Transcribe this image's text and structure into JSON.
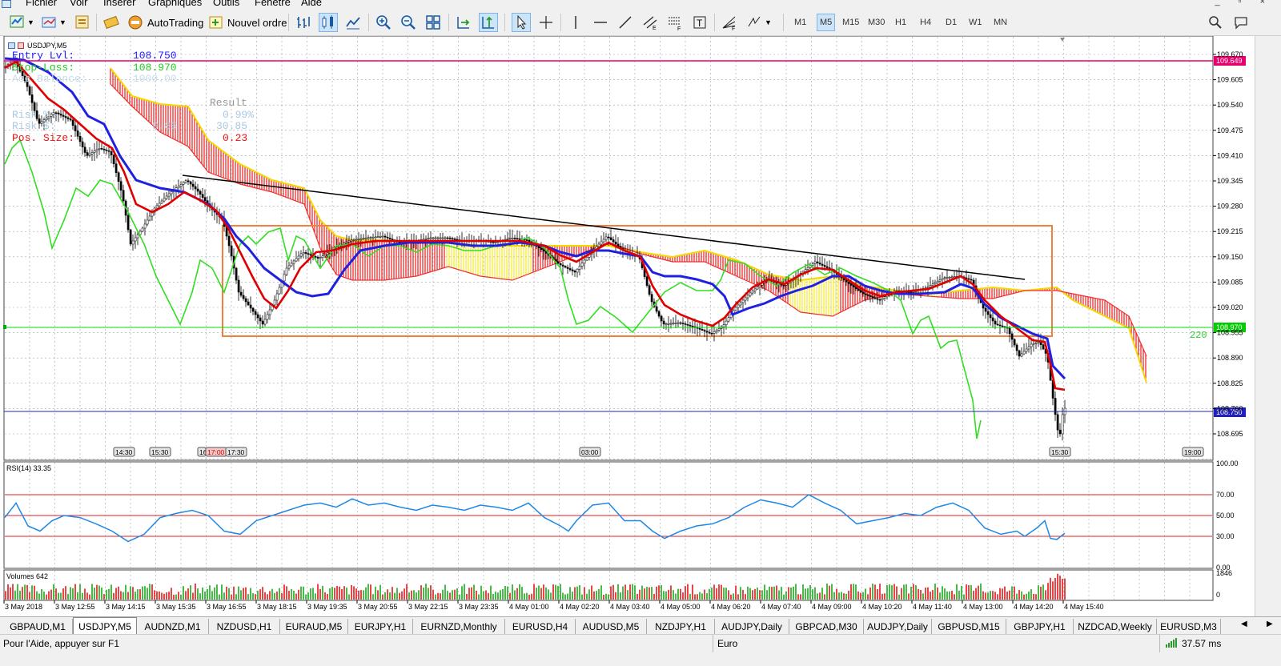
{
  "menu": {
    "items": [
      "Fichier",
      "Voir",
      "Insérer",
      "Graphiques",
      "Outils",
      "Fenêtre",
      "Aide"
    ]
  },
  "toolbar": {
    "autotrading_label": "AutoTrading",
    "new_order_label": "Nouvel ordre",
    "timeframes": [
      "M1",
      "M5",
      "M15",
      "M30",
      "H1",
      "H4",
      "D1",
      "W1",
      "MN"
    ],
    "active_timeframe": "M5"
  },
  "chart": {
    "symbol_title": "USDJPY,M5",
    "overlay": {
      "entry_label": "Entry Lvl:",
      "entry_value": "108.750",
      "stop_label": "Stop-Loss:",
      "stop_value": "108.970",
      "acc_label": "Acc Balance:",
      "acc_value": "1000.00",
      "result_header": "Result",
      "risk_pct_label": "Risk %:",
      "risk_pct_value": "0.99%",
      "risk_money_label": "Risk $:",
      "risk_money_value": "9.85",
      "risk_money_result": "30.85",
      "pos_label": "Pos. Size:",
      "pos_value": "0.23"
    },
    "price_axis": [
      "109.670",
      "109.605",
      "109.540",
      "109.475",
      "109.410",
      "109.345",
      "109.280",
      "109.215",
      "109.150",
      "109.085",
      "109.020",
      "108.955",
      "108.890",
      "108.825",
      "108.760",
      "108.695"
    ],
    "current_price_tag": "109.649",
    "stop_tag": "108.970",
    "entry_tag": "108.750",
    "pips_label": "220",
    "time_tags": [
      "14:30",
      "15:30",
      "16",
      "17:00",
      "17:30",
      "03:00",
      "15:30",
      "19:00"
    ],
    "time_axis": [
      "3 May 2018",
      "3 May 12:55",
      "3 May 14:15",
      "3 May 15:35",
      "3 May 16:55",
      "3 May 18:15",
      "3 May 19:35",
      "3 May 20:55",
      "3 May 22:15",
      "3 May 23:35",
      "4 May 01:00",
      "4 May 02:20",
      "4 May 03:40",
      "4 May 05:00",
      "4 May 06:20",
      "4 May 07:40",
      "4 May 09:00",
      "4 May 10:20",
      "4 May 11:40",
      "4 May 13:00",
      "4 May 14:20",
      "4 May 15:40"
    ],
    "colors": {
      "price_line": "#e8006e",
      "stop_line": "#00dd00",
      "entry_line": "#2020c0",
      "kijun": "#2020e0",
      "tenkan": "#e00000",
      "chikou": "#33dd22",
      "box": "#f08040",
      "trendline": "#000000"
    }
  },
  "rsi": {
    "label": "RSI(14) 33.35",
    "levels": [
      "100.00",
      "70.00",
      "50.00",
      "30.00",
      "0.00"
    ]
  },
  "volumes": {
    "label": "Volumes 642",
    "max": "1846",
    "min": "0"
  },
  "tabs": [
    "GBPAUD,M1",
    "USDJPY,M5",
    "AUDNZD,M1",
    "NZDUSD,H1",
    "EURAUD,M5",
    "EURJPY,H1",
    "EURNZD,Monthly",
    "EURUSD,H4",
    "AUDUSD,M5",
    "NZDJPY,H1",
    "AUDJPY,Daily",
    "GBPCAD,M30",
    "AUDJPY,Daily",
    "GBPUSD,M15",
    "GBPJPY,H1",
    "NZDCAD,Weekly",
    "EURUSD,M3"
  ],
  "active_tab": "USDJPY,M5",
  "status": {
    "help": "Pour l'Aide, appuyer sur F1",
    "profile": "Euro",
    "ping": "37.57 ms"
  }
}
